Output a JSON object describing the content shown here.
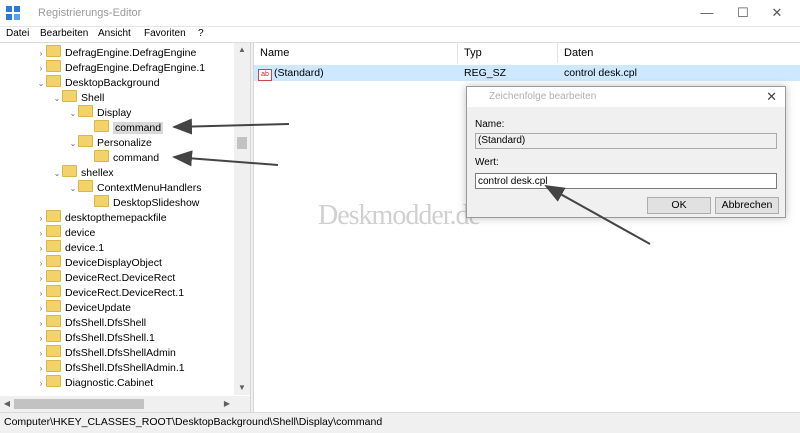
{
  "window": {
    "title": "Registrierungs-Editor",
    "buttons": {
      "minimize": "—",
      "maximize": "☐",
      "close": "✕"
    }
  },
  "menu": [
    "Datei",
    "Bearbeiten",
    "Ansicht",
    "Favoriten",
    "?"
  ],
  "tree": {
    "rows": [
      {
        "label": "DefragEngine.DefragEngine",
        "expander": "›",
        "state": "normal"
      },
      {
        "label": "DefragEngine.DefragEngine.1",
        "expander": "›",
        "state": "normal"
      },
      {
        "label": "DesktopBackground",
        "expander": "⌄",
        "state": "normal"
      },
      {
        "label": "Shell",
        "expander": "⌄",
        "state": "normal"
      },
      {
        "label": "Display",
        "expander": "⌄",
        "state": "normal"
      },
      {
        "label": "command",
        "expander": "",
        "state": "selected"
      },
      {
        "label": "Personalize",
        "expander": "⌄",
        "state": "normal"
      },
      {
        "label": "command",
        "expander": "",
        "state": "normal"
      },
      {
        "label": "shellex",
        "expander": "⌄",
        "state": "normal"
      },
      {
        "label": "ContextMenuHandlers",
        "expander": "⌄",
        "state": "normal"
      },
      {
        "label": "DesktopSlideshow",
        "expander": "",
        "state": "normal"
      },
      {
        "label": "desktopthemepackfile",
        "expander": "›",
        "state": "normal"
      },
      {
        "label": "device",
        "expander": "›",
        "state": "normal"
      },
      {
        "label": "device.1",
        "expander": "›",
        "state": "normal"
      },
      {
        "label": "DeviceDisplayObject",
        "expander": "›",
        "state": "normal"
      },
      {
        "label": "DeviceRect.DeviceRect",
        "expander": "›",
        "state": "normal"
      },
      {
        "label": "DeviceRect.DeviceRect.1",
        "expander": "›",
        "state": "normal"
      },
      {
        "label": "DeviceUpdate",
        "expander": "›",
        "state": "normal"
      },
      {
        "label": "DfsShell.DfsShell",
        "expander": "›",
        "state": "normal"
      },
      {
        "label": "DfsShell.DfsShell.1",
        "expander": "›",
        "state": "normal"
      },
      {
        "label": "DfsShell.DfsShellAdmin",
        "expander": "›",
        "state": "normal"
      },
      {
        "label": "DfsShell.DfsShellAdmin.1",
        "expander": "›",
        "state": "normal"
      },
      {
        "label": "Diagnostic.Cabinet",
        "expander": "›",
        "state": "normal"
      }
    ]
  },
  "list": {
    "headers": {
      "name": "Name",
      "type": "Typ",
      "data": "Daten"
    },
    "row": {
      "icon": "ab",
      "name": "(Standard)",
      "type": "REG_SZ",
      "data": "control desk.cpl"
    }
  },
  "dialog": {
    "title": "Zeichenfolge bearbeiten",
    "name_label": "Name:",
    "name_value": "(Standard)",
    "value_label": "Wert:",
    "value_value": "control desk.cpl",
    "ok_label": "OK",
    "cancel_label": "Abbrechen",
    "close": "✕"
  },
  "watermark": "Deskmodder.de",
  "status": {
    "path": "Computer\\HKEY_CLASSES_ROOT\\DesktopBackground\\Shell\\Display\\command"
  },
  "colors": {
    "selection": "#cde8ff",
    "folder": "#f2d36b",
    "tree_selected": "#d9d9d9"
  }
}
